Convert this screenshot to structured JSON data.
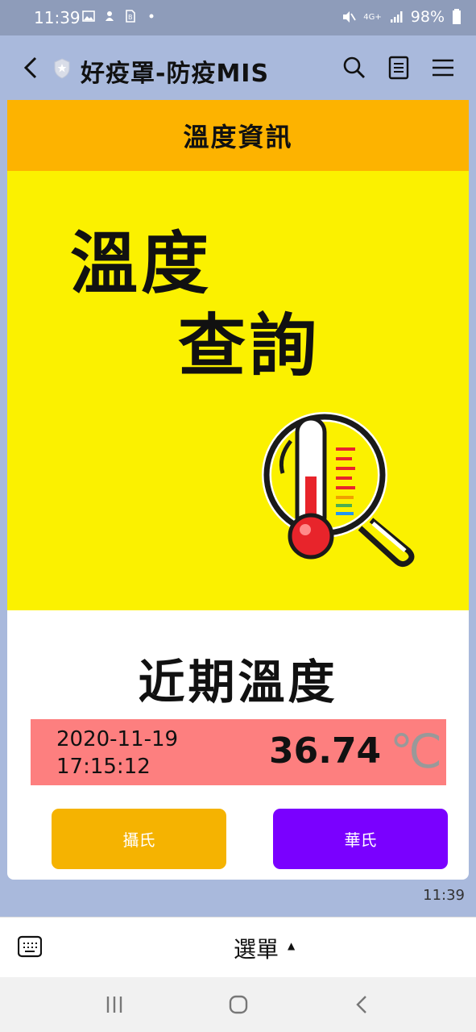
{
  "status_bar": {
    "time": "11:39",
    "battery": "98%",
    "network": "4G+",
    "icons": [
      "image-icon",
      "app-icon",
      "file-icon",
      "dot-icon",
      "mute-icon",
      "signal-icon",
      "battery-icon"
    ]
  },
  "header": {
    "title": "好疫罩-防疫MIS",
    "icons": [
      "back-icon",
      "shield-icon",
      "search-icon",
      "notes-icon",
      "menu-icon"
    ]
  },
  "card": {
    "header_title": "溫度資訊",
    "banner_line1": "溫度",
    "banner_line2": "查詢",
    "recent_title": "近期溫度",
    "reading": {
      "date": "2020-11-19",
      "time": "17:15:12",
      "temperature": "36.74",
      "unit": "℃"
    },
    "buttons": {
      "celsius": "攝氏",
      "fahrenheit": "華氏"
    }
  },
  "message_time": "11:39",
  "bottom_menu": {
    "label": "選單",
    "caret": "▲"
  },
  "colors": {
    "header_bg": "#a9b9dc",
    "status_bg": "#8e9cba",
    "card_header": "#fdb300",
    "banner": "#fbf100",
    "reading_bg": "#fd7f7f",
    "celsius_button": "#f5b301",
    "fahrenheit_button": "#7a00ff"
  }
}
